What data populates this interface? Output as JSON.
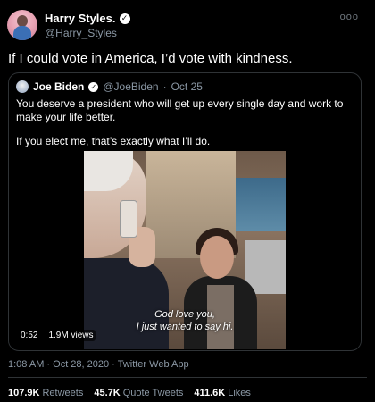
{
  "author": {
    "display_name": "Harry Styles.",
    "handle": "@Harry_Styles",
    "verified_icon": "verified-badge"
  },
  "tweet": {
    "text": "If I could vote in America, I’d vote with kindness.",
    "timestamp": "1:08 AM · Oct 28, 2020 · Twitter Web App"
  },
  "quote": {
    "display_name": "Joe Biden",
    "handle": "@JoeBiden",
    "date": "Oct 25",
    "text_line1": "You deserve a president who will get up every single day and work to make your life better.",
    "text_line2": "If you elect me, that’s exactly what I’ll do."
  },
  "video": {
    "duration": "0:52",
    "views": "1.9M views",
    "caption_line1": "God love you,",
    "caption_line2": "I just wanted to say hi."
  },
  "stats": {
    "retweets_count": "107.9K",
    "retweets_label": "Retweets",
    "quotes_count": "45.7K",
    "quotes_label": "Quote Tweets",
    "likes_count": "411.6K",
    "likes_label": "Likes"
  },
  "colors": {
    "background": "#000000",
    "secondary_text": "#8b98a5",
    "border": "#2f3336"
  }
}
